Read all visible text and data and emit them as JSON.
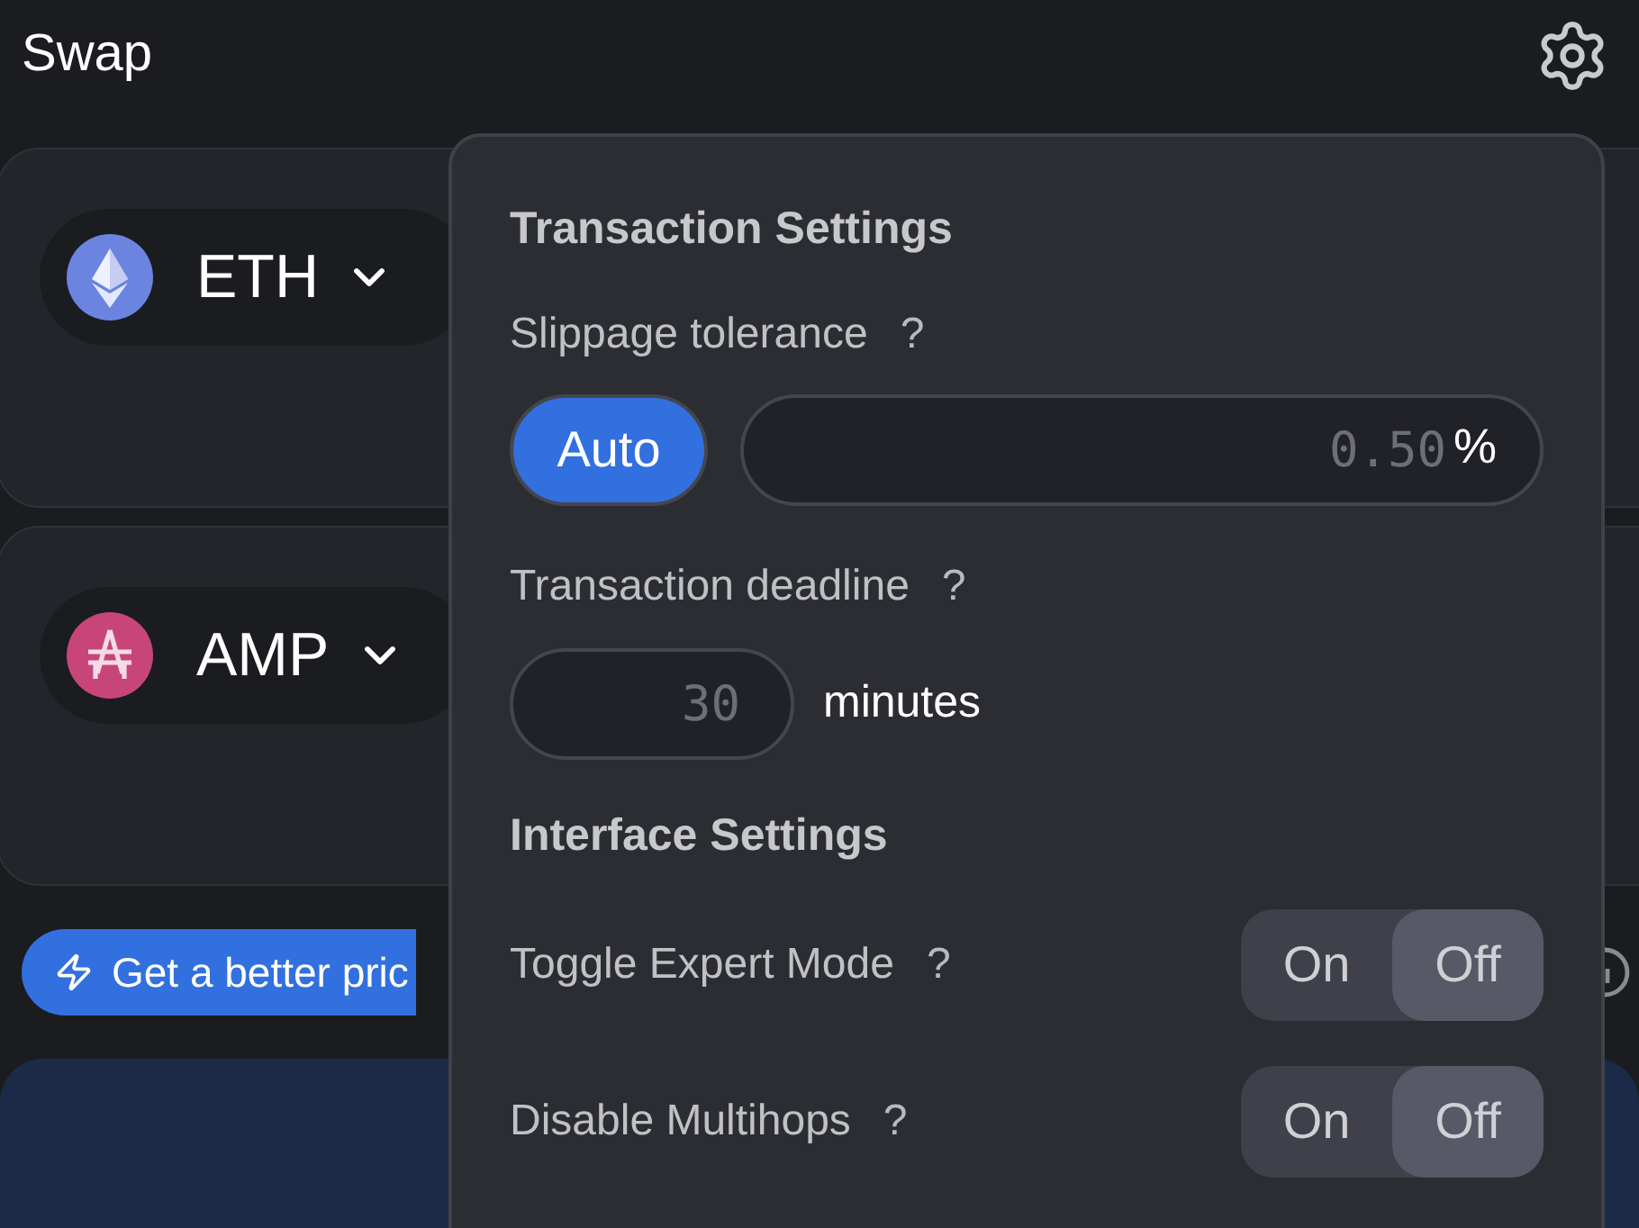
{
  "header": {
    "title": "Swap"
  },
  "tokens": [
    {
      "symbol": "ETH",
      "kind": "eth"
    },
    {
      "symbol": "AMP",
      "kind": "amp"
    }
  ],
  "promo": {
    "label": "Get a better pric"
  },
  "settings": {
    "transaction_title": "Transaction Settings",
    "slippage": {
      "label": "Slippage tolerance",
      "help": "?",
      "auto": {
        "label": "Auto",
        "selected": true
      },
      "input": {
        "placeholder": "0.50",
        "unit": "%"
      }
    },
    "deadline": {
      "label": "Transaction deadline",
      "help": "?",
      "input": {
        "placeholder": "30"
      },
      "unit": "minutes"
    },
    "interface_title": "Interface Settings",
    "toggles": [
      {
        "label": "Toggle Expert Mode",
        "help": "?",
        "options": [
          {
            "label": "On",
            "selected": false
          },
          {
            "label": "Off",
            "selected": true
          }
        ]
      },
      {
        "label": "Disable Multihops",
        "help": "?",
        "options": [
          {
            "label": "On",
            "selected": false
          },
          {
            "label": "Off",
            "selected": true
          }
        ]
      }
    ]
  }
}
